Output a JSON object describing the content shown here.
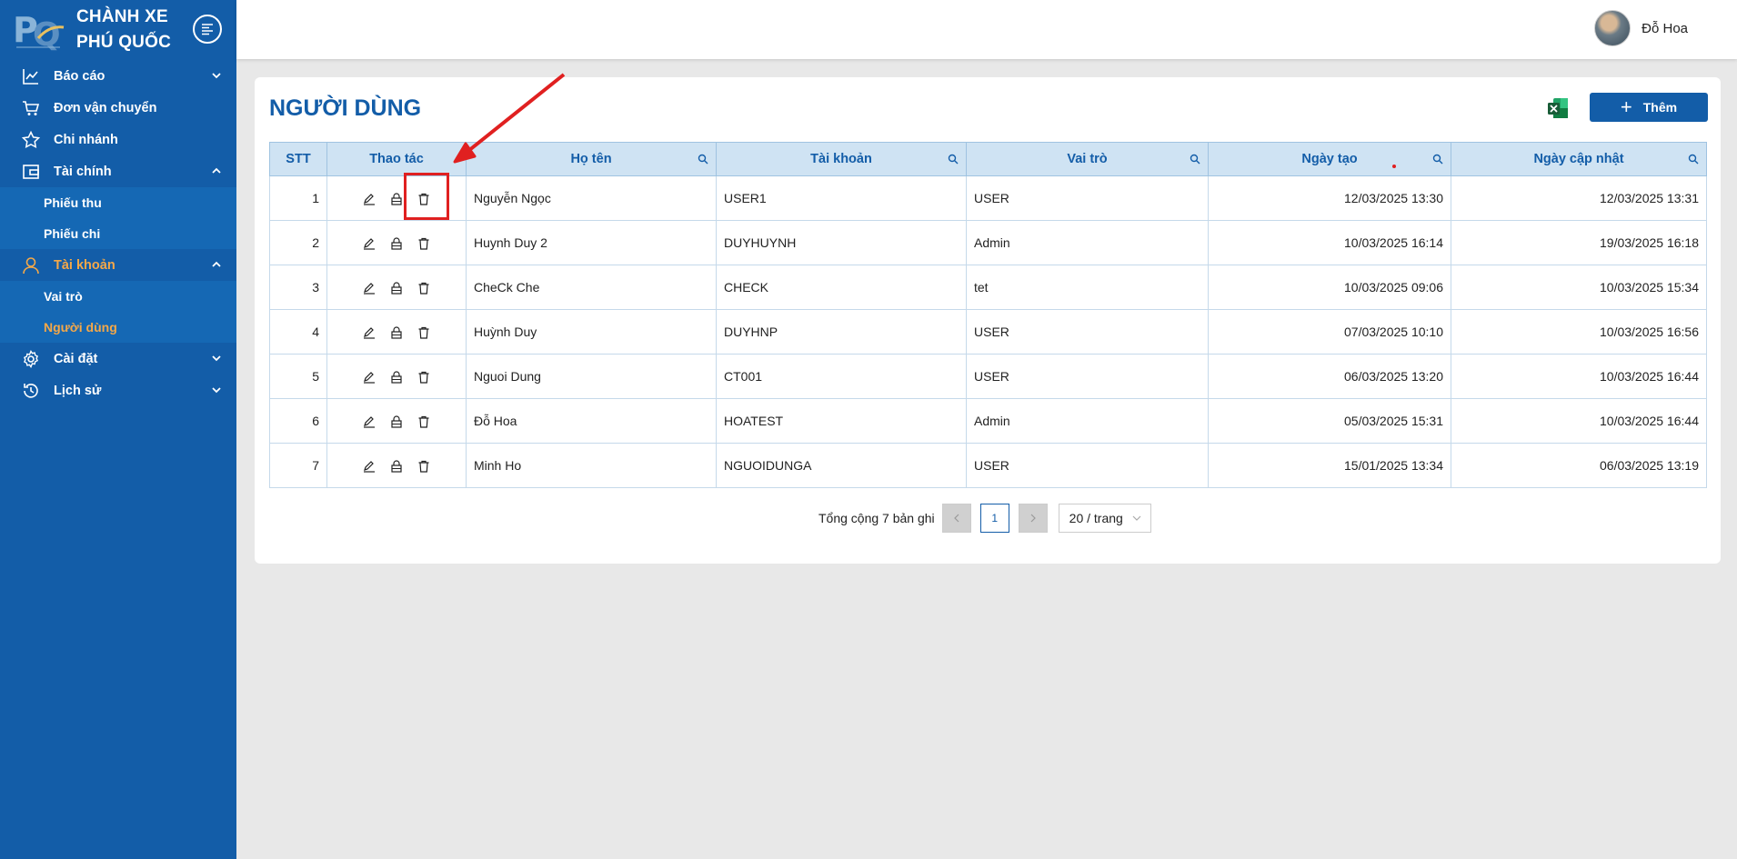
{
  "brand": {
    "line1": "CHÀNH XE",
    "line2": "PHÚ QUỐC"
  },
  "nav": [
    {
      "label": "Báo cáo",
      "icon": "chart-line-icon",
      "chevron": "down"
    },
    {
      "label": "Đơn vận chuyển",
      "icon": "cart-icon",
      "chevron": ""
    },
    {
      "label": "Chi nhánh",
      "icon": "star-icon",
      "chevron": ""
    },
    {
      "label": "Tài chính",
      "icon": "wallet-icon",
      "chevron": "up",
      "sub": [
        "Phiếu thu",
        "Phiếu chi"
      ]
    },
    {
      "label": "Tài khoản",
      "icon": "user-icon",
      "chevron": "up",
      "active": true,
      "sub": [
        "Vai trò",
        "Người dùng"
      ],
      "active_sub": "Người dùng"
    },
    {
      "label": "Cài đặt",
      "icon": "gear-icon",
      "chevron": "down"
    },
    {
      "label": "Lịch sử",
      "icon": "history-icon",
      "chevron": "down"
    }
  ],
  "header": {
    "user_name": "Đỗ Hoa"
  },
  "page": {
    "title": "NGƯỜI DÙNG",
    "add_label": "Thêm"
  },
  "table": {
    "columns": [
      "STT",
      "Thao tác",
      "Họ tên",
      "Tài khoản",
      "Vai trò",
      "Ngày tạo",
      "Ngày cập nhật"
    ],
    "rows": [
      {
        "stt": "1",
        "name": "Nguyễn Ngọc",
        "account": "USER1",
        "role": "USER",
        "created": "12/03/2025 13:30",
        "updated": "12/03/2025 13:31"
      },
      {
        "stt": "2",
        "name": "Huynh Duy 2",
        "account": "DUYHUYNH",
        "role": "Admin",
        "created": "10/03/2025 16:14",
        "updated": "19/03/2025 16:18"
      },
      {
        "stt": "3",
        "name": "CheCk Che",
        "account": "CHECK",
        "role": "tet",
        "created": "10/03/2025 09:06",
        "updated": "10/03/2025 15:34"
      },
      {
        "stt": "4",
        "name": "Huỳnh Duy",
        "account": "DUYHNP",
        "role": "USER",
        "created": "07/03/2025 10:10",
        "updated": "10/03/2025 16:56"
      },
      {
        "stt": "5",
        "name": "Nguoi Dung",
        "account": "CT001",
        "role": "USER",
        "created": "06/03/2025 13:20",
        "updated": "10/03/2025 16:44"
      },
      {
        "stt": "6",
        "name": "Đỗ Hoa",
        "account": "HOATEST",
        "role": "Admin",
        "created": "05/03/2025 15:31",
        "updated": "10/03/2025 16:44"
      },
      {
        "stt": "7",
        "name": "Minh Ho",
        "account": "NGUOIDUNGA",
        "role": "USER",
        "created": "15/01/2025 13:34",
        "updated": "06/03/2025 13:19"
      }
    ]
  },
  "pagination": {
    "total_text": "Tổng cộng 7 bản ghi",
    "current": "1",
    "page_size": "20 / trang"
  },
  "colors": {
    "primary": "#135da8",
    "accent": "#f5a848",
    "annotation": "#e02020"
  }
}
